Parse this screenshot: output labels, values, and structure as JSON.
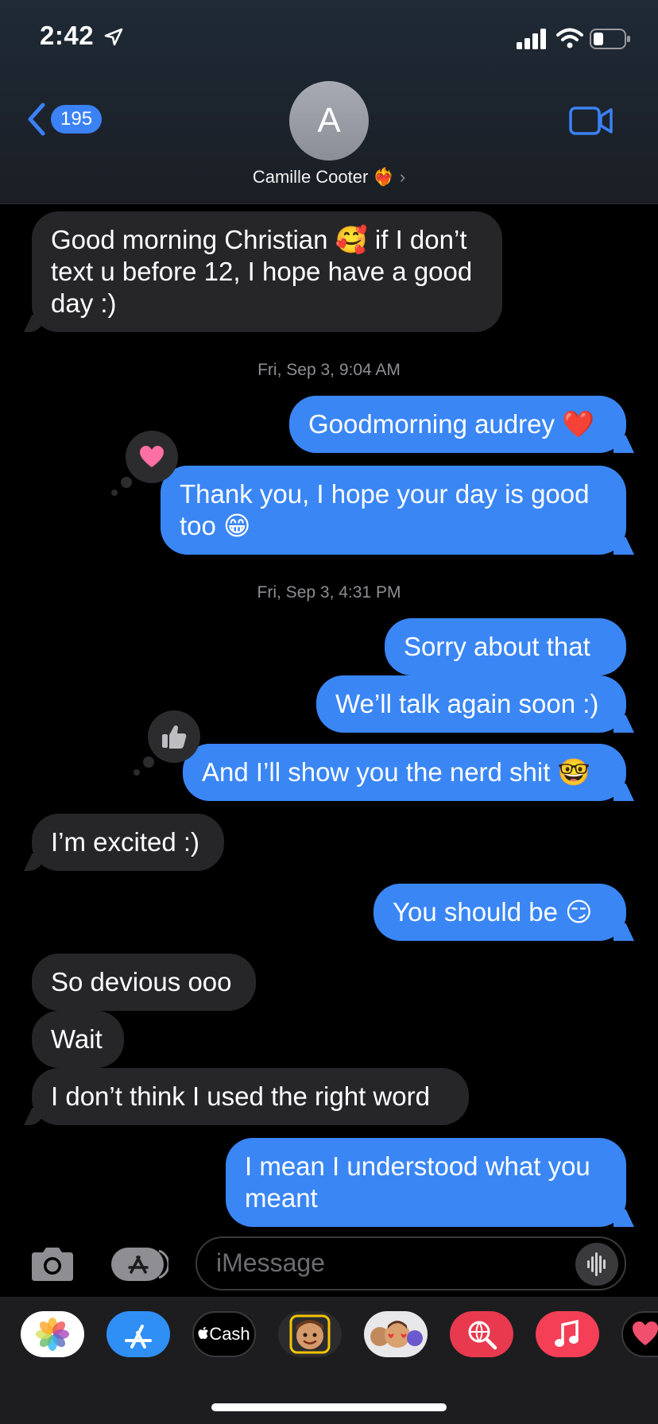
{
  "status_bar": {
    "time": "2:42"
  },
  "header": {
    "back_count": "195",
    "avatar_initial": "A",
    "contact_name": "Camille Cooter ❤️‍🔥",
    "chevron": "›"
  },
  "messages": [
    {
      "direction": "in",
      "text": "Good morning Christian 🥰 if I don’t text u before 12, I hope have a good day :)"
    },
    {
      "type": "timestamp",
      "text": "Fri, Sep 3, 9:04 AM"
    },
    {
      "direction": "out",
      "text": "Goodmorning audrey ❤️"
    },
    {
      "direction": "out",
      "text": "Thank you, I hope your day is good too 😁",
      "tapback": "heart"
    },
    {
      "type": "timestamp",
      "text": "Fri, Sep 3, 4:31 PM"
    },
    {
      "direction": "out",
      "text": "Sorry about that"
    },
    {
      "direction": "out",
      "text": "We’ll talk again soon :)"
    },
    {
      "direction": "out",
      "text": "And I’ll show you the nerd shit 🤓",
      "tapback": "thumbs-up"
    },
    {
      "direction": "in",
      "text": "I’m excited :)"
    },
    {
      "direction": "out",
      "text": "You should be 😏"
    },
    {
      "direction": "in",
      "text": "So devious ooo"
    },
    {
      "direction": "in",
      "text": "Wait"
    },
    {
      "direction": "in",
      "text": "I don’t think I used the right word"
    },
    {
      "direction": "out",
      "text": "I mean I understood what you meant"
    }
  ],
  "compose": {
    "placeholder": "iMessage"
  },
  "tray": {
    "apps": [
      "photos-icon",
      "app-store-icon",
      "apple-cash-icon",
      "memoji-icon",
      "animoji-stickers-icon",
      "image-search-icon",
      "music-icon",
      "digital-touch-icon"
    ],
    "cash_label": "Cash"
  },
  "colors": {
    "outgoing": "#3a86f5",
    "incoming": "#262628",
    "accent": "#3b82f6",
    "heart": "#ff6fa3"
  }
}
